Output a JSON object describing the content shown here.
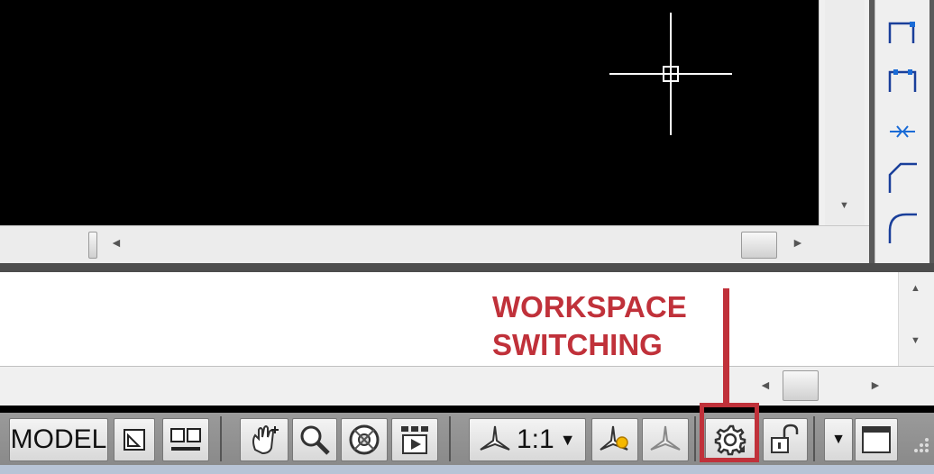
{
  "status_bar": {
    "model_label": "MODEL",
    "scale_label": "1:1",
    "scale_arrow": "▼",
    "menu_arrow": "▼"
  },
  "annotation": {
    "line1": "WORKSPACE",
    "line2": "SWITCHING",
    "color": "#c0313a"
  },
  "icons": {
    "toolbar": [
      "top-edge-align-icon",
      "connect-icon",
      "compress-icon",
      "chamfer-icon",
      "fillet-icon"
    ],
    "status": [
      "layout-model-icon",
      "quick-view-layouts-icon",
      "pan-icon",
      "zoom-icon",
      "steering-wheel-icon",
      "showmotion-icon",
      "annotation-scale-icon",
      "annotation-visibility-icon",
      "autoscale-icon",
      "workspace-switching-gear-icon",
      "toolbar-lock-icon",
      "status-menu-icon",
      "clean-screen-icon"
    ]
  },
  "colors": {
    "accent": "#c0313a",
    "canvas": "#000000"
  }
}
